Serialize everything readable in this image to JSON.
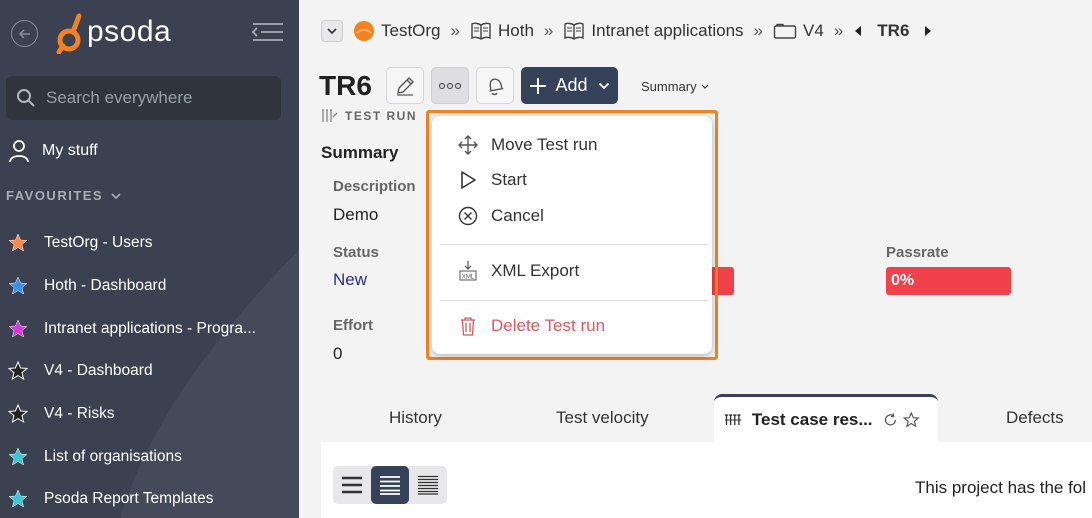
{
  "sidebar": {
    "logo_text": "psoda",
    "search_placeholder": "Search everywhere",
    "my_stuff": "My stuff",
    "favourites_heading": "FAVOURITES",
    "favourites": [
      {
        "label": "TestOrg - Users",
        "color": "#f58a4a"
      },
      {
        "label": "Hoth - Dashboard",
        "color": "#3d8ee8"
      },
      {
        "label": "Intranet applications - Progra...",
        "color": "#d63ad6"
      },
      {
        "label": "V4 - Dashboard",
        "color": "#222222"
      },
      {
        "label": "V4 - Risks",
        "color": "#222222"
      },
      {
        "label": "List of organisations",
        "color": "#3cc5d8"
      },
      {
        "label": "Psoda Report Templates",
        "color": "#3cc5d8"
      }
    ]
  },
  "breadcrumb": {
    "items": [
      "TestOrg",
      "Hoth",
      "Intranet applications",
      "V4"
    ],
    "current": "TR6"
  },
  "header": {
    "title": "TR6",
    "add_label": "Add",
    "summary_label": "Summary",
    "subtype": "TEST RUN"
  },
  "summary": {
    "heading": "Summary",
    "description_label": "Description",
    "description_value": "Demo",
    "status_label": "Status",
    "status_value": "New",
    "effort_label": "Effort",
    "effort_value": "0",
    "passrate_label": "Passrate",
    "passrate_value": "0%"
  },
  "menu": {
    "items": [
      "Move Test run",
      "Start",
      "Cancel",
      "XML Export",
      "Delete Test run"
    ]
  },
  "tabs": [
    "History",
    "Test velocity",
    "Test case res...",
    "Defects"
  ],
  "panel": {
    "text": "This project has the fol"
  },
  "colors": {
    "accent": "#36415a",
    "highlight": "#f58220",
    "danger": "#f0404a"
  }
}
